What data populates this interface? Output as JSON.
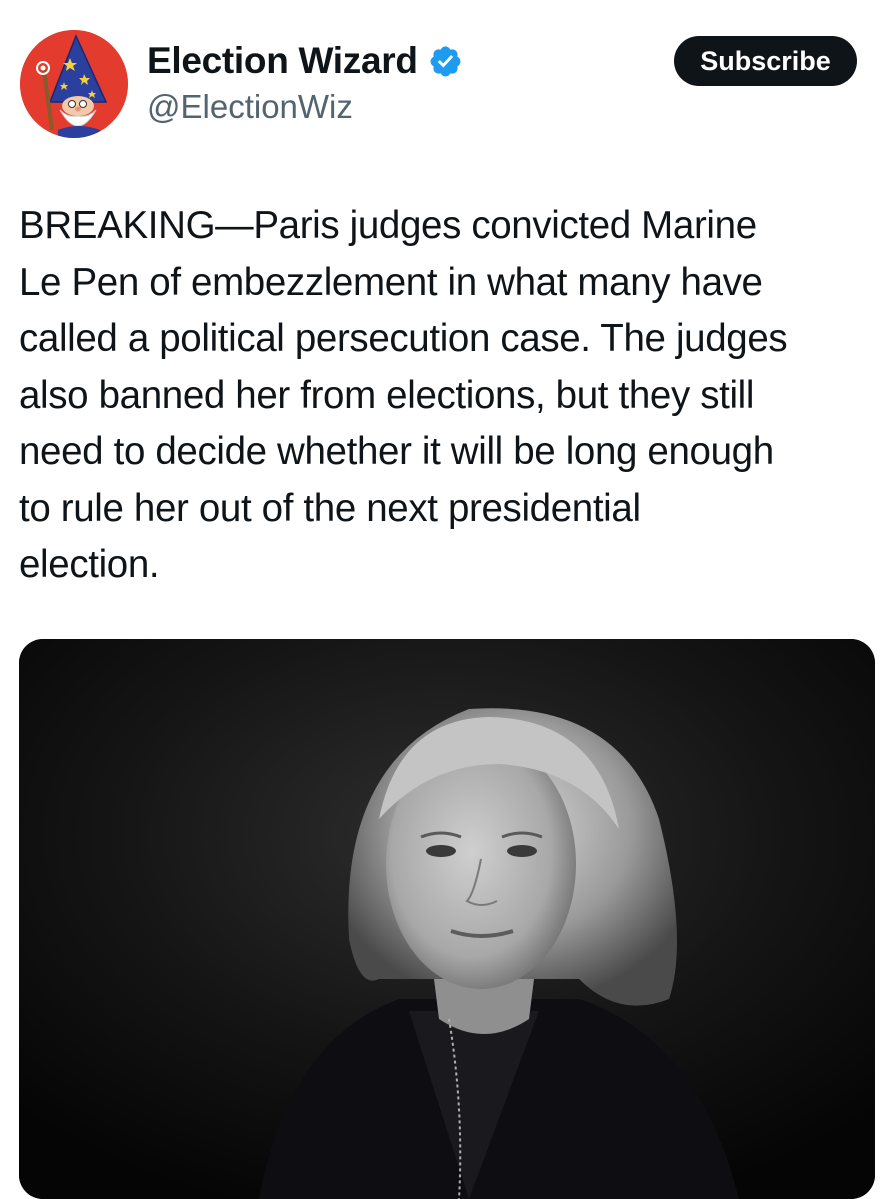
{
  "tweet": {
    "author": {
      "display_name": "Election Wizard",
      "handle": "@ElectionWiz",
      "verified": true,
      "avatar_icon": "wizard-avatar-icon",
      "avatar_color": "#e33b2e"
    },
    "subscribe_label": "Subscribe",
    "text": "BREAKING—Paris judges convicted Marine\nLe Pen of embezzlement in what many have\ncalled a political persecution case. The judges\nalso banned her from elections, but they still\nneed to decide whether it will be long enough\nto rule her out of the next presidential\nelection.",
    "media": {
      "type": "photo",
      "description_icon": "portrait-photo"
    }
  },
  "colors": {
    "text": "#0f1419",
    "secondary": "#536471",
    "verified_blue": "#1d9bf0",
    "button_bg": "#0f1419"
  }
}
